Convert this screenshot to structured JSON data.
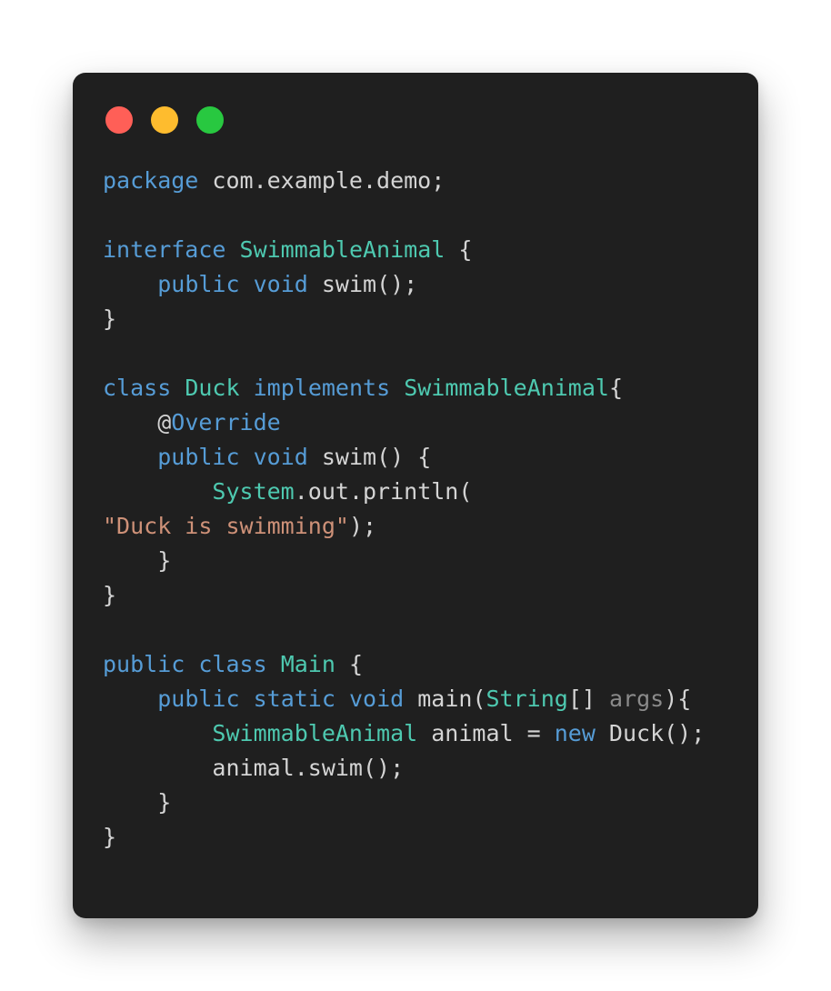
{
  "window": {
    "controls": [
      {
        "name": "close-button",
        "color": "#ff5f57"
      },
      {
        "name": "minimize-button",
        "color": "#febc2e"
      },
      {
        "name": "maximize-button",
        "color": "#28c840"
      }
    ]
  },
  "colors": {
    "default": "#d4d4d4",
    "keyword": "#569cd6",
    "type": "#4ec9b0",
    "string": "#ce9178",
    "param": "#8a8a8a",
    "background": "#1f1f1f"
  },
  "code": {
    "language": "java",
    "lines": [
      [
        [
          "keyword",
          "package"
        ],
        [
          "default",
          " com.example.demo;"
        ]
      ],
      [],
      [
        [
          "keyword",
          "interface"
        ],
        [
          "default",
          " "
        ],
        [
          "type",
          "SwimmableAnimal"
        ],
        [
          "default",
          " {"
        ]
      ],
      [
        [
          "default",
          "    "
        ],
        [
          "keyword",
          "public"
        ],
        [
          "default",
          " "
        ],
        [
          "keyword",
          "void"
        ],
        [
          "default",
          " swim();"
        ]
      ],
      [
        [
          "default",
          "}"
        ]
      ],
      [],
      [
        [
          "keyword",
          "class"
        ],
        [
          "default",
          " "
        ],
        [
          "type",
          "Duck"
        ],
        [
          "default",
          " "
        ],
        [
          "keyword",
          "implements"
        ],
        [
          "default",
          " "
        ],
        [
          "type",
          "SwimmableAnimal"
        ],
        [
          "default",
          "{"
        ]
      ],
      [
        [
          "default",
          "    @"
        ],
        [
          "keyword",
          "Override"
        ]
      ],
      [
        [
          "default",
          "    "
        ],
        [
          "keyword",
          "public"
        ],
        [
          "default",
          " "
        ],
        [
          "keyword",
          "void"
        ],
        [
          "default",
          " swim() {"
        ]
      ],
      [
        [
          "default",
          "        "
        ],
        [
          "type",
          "System"
        ],
        [
          "default",
          ".out.println("
        ]
      ],
      [
        [
          "string",
          "\"Duck is swimming\""
        ],
        [
          "default",
          ");"
        ]
      ],
      [
        [
          "default",
          "    }"
        ]
      ],
      [
        [
          "default",
          "}"
        ]
      ],
      [],
      [
        [
          "keyword",
          "public"
        ],
        [
          "default",
          " "
        ],
        [
          "keyword",
          "class"
        ],
        [
          "default",
          " "
        ],
        [
          "type",
          "Main"
        ],
        [
          "default",
          " {"
        ]
      ],
      [
        [
          "default",
          "    "
        ],
        [
          "keyword",
          "public"
        ],
        [
          "default",
          " "
        ],
        [
          "keyword",
          "static"
        ],
        [
          "default",
          " "
        ],
        [
          "keyword",
          "void"
        ],
        [
          "default",
          " main("
        ],
        [
          "type",
          "String"
        ],
        [
          "default",
          "[] "
        ],
        [
          "param",
          "args"
        ],
        [
          "default",
          "){"
        ]
      ],
      [
        [
          "default",
          "        "
        ],
        [
          "type",
          "SwimmableAnimal"
        ],
        [
          "default",
          " animal = "
        ],
        [
          "keyword",
          "new"
        ],
        [
          "default",
          " Duck();"
        ]
      ],
      [
        [
          "default",
          "        animal.swim();"
        ]
      ],
      [
        [
          "default",
          "    }"
        ]
      ],
      [
        [
          "default",
          "}"
        ]
      ]
    ]
  }
}
